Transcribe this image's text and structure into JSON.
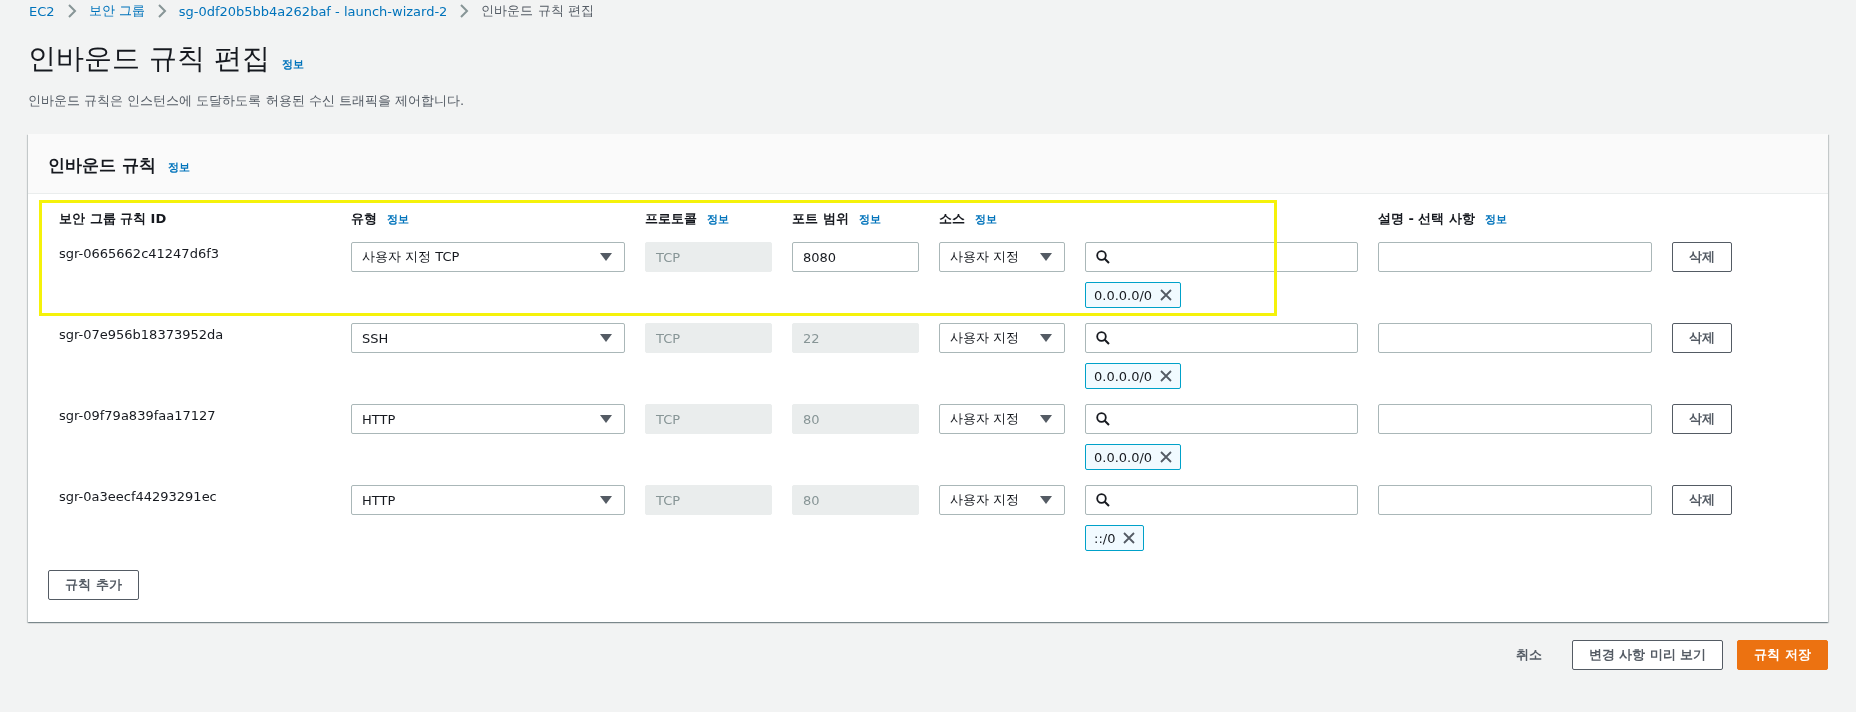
{
  "breadcrumbs": [
    {
      "label": "EC2",
      "link": true
    },
    {
      "label": "보안 그룹",
      "link": true
    },
    {
      "label": "sg-0df20b5bb4a262baf - launch-wizard-2",
      "link": true
    },
    {
      "label": "인바운드 규칙 편집",
      "link": false
    }
  ],
  "page": {
    "title": "인바운드 규칙 편집",
    "info": "정보",
    "description": "인바운드 규칙은 인스턴스에 도달하도록 허용된 수신 트래픽을 제어합니다."
  },
  "panel": {
    "title": "인바운드 규칙",
    "info": "정보",
    "columns": [
      {
        "label": "보안 그룹 규칙 ID"
      },
      {
        "label": "유형",
        "info": "정보"
      },
      {
        "label": "프로토콜",
        "info": "정보"
      },
      {
        "label": "포트 범위",
        "info": "정보"
      },
      {
        "label": "소스",
        "info": "정보"
      },
      {
        "label": "설명 - 선택 사항",
        "info": "정보"
      }
    ],
    "rows": [
      {
        "id": "sgr-0665662c41247d6f3",
        "type": "사용자 지정 TCP",
        "protocol": "TCP",
        "port": "8080",
        "port_disabled": false,
        "source": "사용자 지정",
        "source_token": "0.0.0.0/0",
        "delete": "삭제",
        "highlighted": true
      },
      {
        "id": "sgr-07e956b18373952da",
        "type": "SSH",
        "protocol": "TCP",
        "port": "22",
        "port_disabled": true,
        "source": "사용자 지정",
        "source_token": "0.0.0.0/0",
        "delete": "삭제",
        "highlighted": false
      },
      {
        "id": "sgr-09f79a839faa17127",
        "type": "HTTP",
        "protocol": "TCP",
        "port": "80",
        "port_disabled": true,
        "source": "사용자 지정",
        "source_token": "0.0.0.0/0",
        "delete": "삭제",
        "highlighted": false
      },
      {
        "id": "sgr-0a3eecf44293291ec",
        "type": "HTTP",
        "protocol": "TCP",
        "port": "80",
        "port_disabled": true,
        "source": "사용자 지정",
        "source_token": "::/0",
        "delete": "삭제",
        "highlighted": false
      }
    ],
    "add_button": "규칙 추가"
  },
  "footer": {
    "cancel": "취소",
    "preview": "변경 사항 미리 보기",
    "save": "규칙 저장"
  }
}
